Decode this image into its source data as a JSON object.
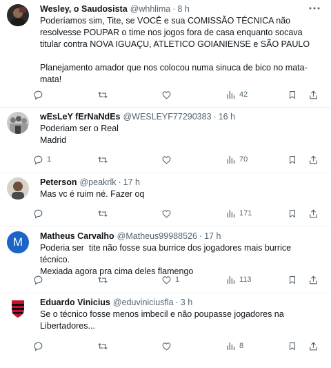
{
  "tweets": [
    {
      "name": "Wesley, o Saudosista",
      "handle": "@whhlima",
      "time": "8 h",
      "text": "Poderíamos sim, Tite, se VOCÊ e sua COMISSÃO TÉCNICA não resolvesse POUPAR o time nos jogos fora de casa enquanto socava titular contra NOVA IGUAÇU, ATLETICO GOIANIENSE e SÃO PAULO\n\nPlanejamento amador que nos colocou numa sinuca de bico no mata-mata!",
      "replies": "",
      "retweets": "",
      "likes": "",
      "views": "42",
      "avatar_icon": "dark-portrait-icon"
    },
    {
      "name": "wEsLeY fErNaNdEs",
      "handle": "@WESLEYF77290383",
      "time": "16 h",
      "text": "Poderiam ser o Real\nMadrid",
      "replies": "1",
      "retweets": "",
      "likes": "",
      "views": "70",
      "avatar_icon": "crowd-photo-icon"
    },
    {
      "name": "Peterson",
      "handle": "@peakrlk",
      "time": "17 h",
      "text": "Mas vc é ruim né. Fazer oq",
      "replies": "",
      "retweets": "",
      "likes": "",
      "views": "171",
      "avatar_icon": "portrait-photo-icon"
    },
    {
      "name": "Matheus Carvalho",
      "handle": "@Matheus99988526",
      "time": "17 h",
      "text": "Poderia ser  tite não fosse sua burrice dos jogadores mais burrice técnico.\nMexiada agora pra cima deles flamengo",
      "replies": "",
      "retweets": "",
      "likes": "1",
      "views": "113",
      "avatar_icon": "letter-m-avatar-icon",
      "avatar_letter": "M"
    },
    {
      "name": "Eduardo Vinicius",
      "handle": "@eduviniciusfla",
      "time": "3 h",
      "text": "Se o técnico fosse menos imbecil e não poupasse jogadores na\nLibertadores...",
      "replies": "",
      "retweets": "",
      "likes": "",
      "views": "8",
      "avatar_icon": "flamengo-crest-icon"
    }
  ],
  "colors": {
    "text": "#0f1419",
    "secondary": "#536471",
    "divider": "#eff3f4",
    "avatar_blue": "#1d64c8",
    "flamengo_red": "#c8102e"
  }
}
